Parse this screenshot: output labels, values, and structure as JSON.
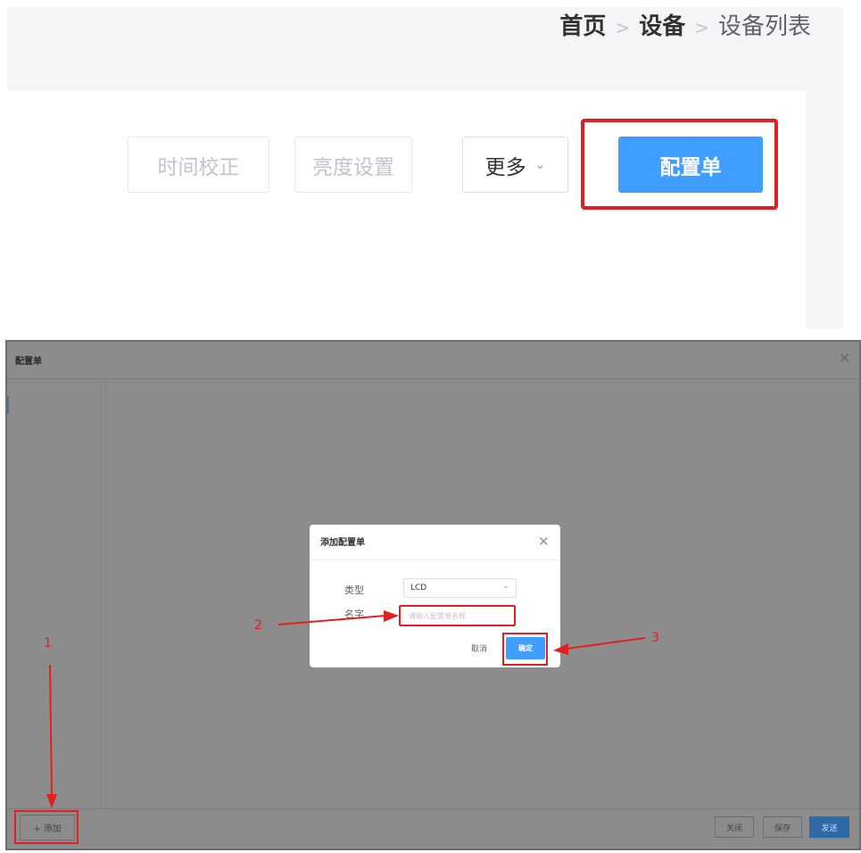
{
  "breadcrumb": {
    "home": "首页",
    "device": "设备",
    "current": "设备列表",
    "separator": ">"
  },
  "toolbar": {
    "time_correct": "时间校正",
    "brightness": "亮度设置",
    "more": "更多",
    "config": "配置单"
  },
  "dialog": {
    "title": "配置单",
    "add_button": "+ 添加",
    "footer": {
      "close": "关闭",
      "save": "保存",
      "send": "发送"
    }
  },
  "modal": {
    "title": "添加配置单",
    "type_label": "类型",
    "type_value": "LCD",
    "name_label": "名字",
    "name_placeholder": "请输入配置单名称",
    "cancel": "取消",
    "ok": "确定"
  },
  "annotations": {
    "step1": "1",
    "step2": "2",
    "step3": "3",
    "color": "#e02020"
  },
  "icons": {
    "close": "close-icon",
    "chevron": "chevron-down-icon"
  }
}
